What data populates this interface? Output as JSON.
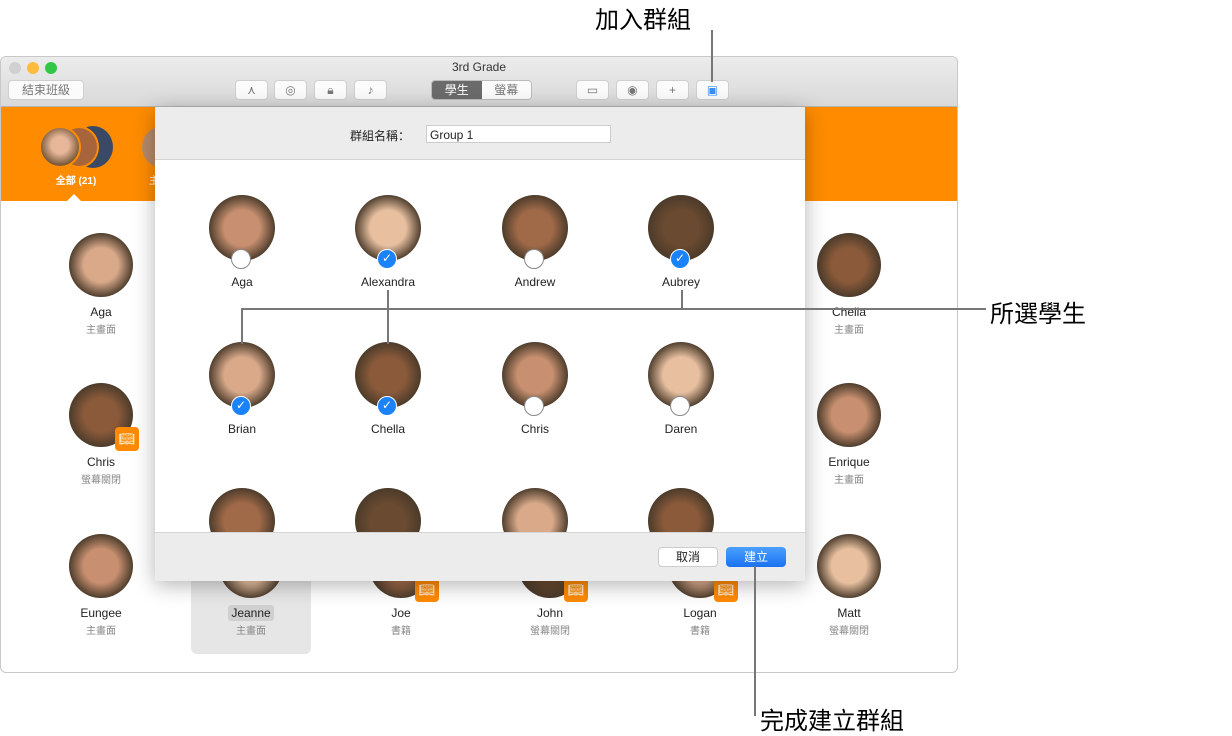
{
  "window": {
    "title": "3rd Grade",
    "end_class": "結束班級",
    "segments": [
      "學生",
      "螢幕"
    ],
    "toolbar_icons": [
      "app-store-icon",
      "safari-icon",
      "lock-icon",
      "mute-icon",
      "airplay-icon",
      "person-add-icon",
      "plus-icon",
      "group-icon"
    ]
  },
  "groups": [
    {
      "label": "全部 (21)"
    },
    {
      "label": "主"
    }
  ],
  "background_students": [
    {
      "name": "Aga",
      "status": "主畫面",
      "col": 0,
      "row": 0,
      "badge": false
    },
    {
      "name": "Chris",
      "status": "螢幕關閉",
      "col": 0,
      "row": 1,
      "badge": true
    },
    {
      "name": "Eungee",
      "status": "主畫面",
      "col": 0,
      "row": 2,
      "badge": false
    },
    {
      "name": "Jeanne",
      "status": "主畫面",
      "col": 1,
      "row": 2,
      "badge": false,
      "selected": true
    },
    {
      "name": "Joe",
      "status": "書籍",
      "col": 2,
      "row": 2,
      "badge": true
    },
    {
      "name": "John",
      "status": "螢幕關閉",
      "col": 3,
      "row": 2,
      "badge": true
    },
    {
      "name": "Logan",
      "status": "書籍",
      "col": 4,
      "row": 2,
      "badge": true
    },
    {
      "name": "Chella",
      "status": "主畫面",
      "col": 5,
      "row": 0,
      "badge": false
    },
    {
      "name": "Enrique",
      "status": "主畫面",
      "col": 5,
      "row": 1,
      "badge": false
    },
    {
      "name": "Matt",
      "status": "螢幕關閉",
      "col": 5,
      "row": 2,
      "badge": false
    }
  ],
  "dialog": {
    "group_name_label": "群組名稱：",
    "group_name_value": "Group 1",
    "cancel": "取消",
    "create": "建立",
    "students": [
      {
        "name": "Aga",
        "checked": false
      },
      {
        "name": "Alexandra",
        "checked": true
      },
      {
        "name": "Andrew",
        "checked": false
      },
      {
        "name": "Aubrey",
        "checked": true
      },
      {
        "name": "Brian",
        "checked": true
      },
      {
        "name": "Chella",
        "checked": true
      },
      {
        "name": "Chris",
        "checked": false
      },
      {
        "name": "Daren",
        "checked": false
      },
      {
        "name": "",
        "checked": false
      },
      {
        "name": "",
        "checked": false
      },
      {
        "name": "",
        "checked": false
      },
      {
        "name": "",
        "checked": false
      }
    ]
  },
  "annotations": {
    "add_group": "加入群組",
    "selected_students": "所選學生",
    "finish_create": "完成建立群組"
  },
  "colors": {
    "accent": "#ff8c00",
    "blue": "#1a82fb",
    "badge": "#ff8a00"
  }
}
